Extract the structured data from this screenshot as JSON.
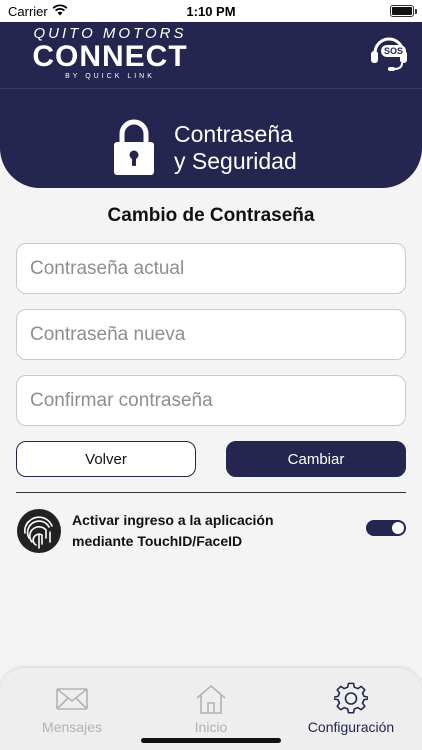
{
  "status_bar": {
    "carrier": "Carrier",
    "time": "1:10 PM"
  },
  "header": {
    "logo_top": "QUITO MOTORS",
    "logo_main": "CONNECT",
    "logo_sub": "BY QUICK LINK",
    "sos_label": "SOS",
    "sos_icon": "headset-icon"
  },
  "section": {
    "title": "Contraseña\ny Seguridad",
    "icon": "lock-icon"
  },
  "form": {
    "title": "Cambio de Contraseña",
    "current_password": {
      "placeholder": "Contraseña actual",
      "value": ""
    },
    "new_password": {
      "placeholder": "Contraseña nueva",
      "value": ""
    },
    "confirm_password": {
      "placeholder": "Confirmar contraseña",
      "value": ""
    },
    "back_label": "Volver",
    "change_label": "Cambiar"
  },
  "biometric": {
    "label": "Activar ingreso a la aplicación mediante TouchID/FaceID",
    "enabled": true,
    "icon": "fingerprint-icon"
  },
  "tabs": [
    {
      "label": "Mensajes",
      "icon": "envelope-icon",
      "active": false
    },
    {
      "label": "Inicio",
      "icon": "home-icon",
      "active": false
    },
    {
      "label": "Configuración",
      "icon": "gear-icon",
      "active": true
    }
  ],
  "colors": {
    "brand_navy": "#24264f",
    "background": "#f4f4f4",
    "inactive_tab": "#b3b3b3"
  }
}
